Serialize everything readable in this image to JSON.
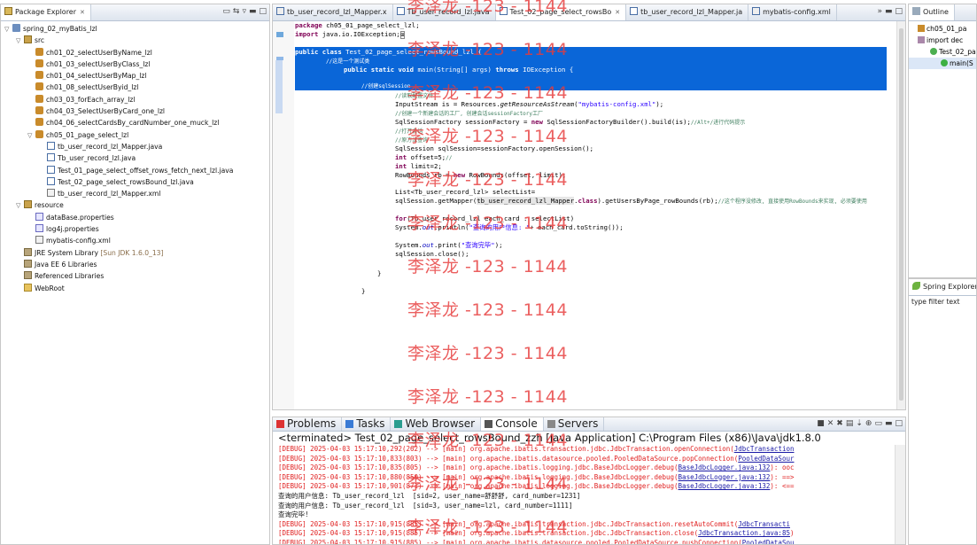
{
  "colors": {
    "selection": "#0a66d8",
    "keyword": "#7f0055",
    "comment": "#3f7f5f",
    "string": "#2a00ff",
    "error_log": "#e02020",
    "watermark": "#e63c3c"
  },
  "package_explorer": {
    "title": "Package Explorer",
    "tree": [
      {
        "label": "spring_02_myBatis_lzl",
        "icon": "project-icon",
        "indent": 0,
        "twisty": "▽"
      },
      {
        "label": "src",
        "icon": "source-folder-icon",
        "indent": 1,
        "twisty": "▽"
      },
      {
        "label": "ch01_02_selectUserByName_lzl",
        "icon": "package-icon",
        "indent": 2,
        "twisty": ""
      },
      {
        "label": "ch01_03_selectUserByClass_lzl",
        "icon": "package-icon",
        "indent": 2,
        "twisty": ""
      },
      {
        "label": "ch01_04_selectUserByMap_lzl",
        "icon": "package-icon",
        "indent": 2,
        "twisty": ""
      },
      {
        "label": "ch01_08_selectUserByid_lzl",
        "icon": "package-icon",
        "indent": 2,
        "twisty": ""
      },
      {
        "label": "ch03_03_forEach_array_lzl",
        "icon": "package-icon",
        "indent": 2,
        "twisty": ""
      },
      {
        "label": "ch04_03_SelectUserByCard_one_lzl",
        "icon": "package-icon",
        "indent": 2,
        "twisty": ""
      },
      {
        "label": "ch04_06_selectCardsBy_cardNumber_one_muck_lzl",
        "icon": "package-icon",
        "indent": 2,
        "twisty": ""
      },
      {
        "label": "ch05_01_page_select_lzl",
        "icon": "package-icon",
        "indent": 2,
        "twisty": "▽"
      },
      {
        "label": "tb_user_record_lzl_Mapper.java",
        "icon": "java-file-icon",
        "indent": 3,
        "twisty": ""
      },
      {
        "label": "Tb_user_record_lzl.java",
        "icon": "java-file-icon",
        "indent": 3,
        "twisty": ""
      },
      {
        "label": "Test_01_page_select_offset_rows_fetch_next_lzl.java",
        "icon": "java-file-icon",
        "indent": 3,
        "twisty": ""
      },
      {
        "label": "Test_02_page_select_rowsBound_lzl.java",
        "icon": "java-file-icon",
        "indent": 3,
        "twisty": ""
      },
      {
        "label": "tb_user_record_lzl_Mapper.xml",
        "icon": "xml-file-icon",
        "indent": 3,
        "twisty": ""
      },
      {
        "label": "resource",
        "icon": "source-folder-icon",
        "indent": 1,
        "twisty": "▽"
      },
      {
        "label": "dataBase.properties",
        "icon": "properties-file-icon",
        "indent": 2,
        "twisty": ""
      },
      {
        "label": "log4j.properties",
        "icon": "properties-file-icon",
        "indent": 2,
        "twisty": ""
      },
      {
        "label": "mybatis-config.xml",
        "icon": "xml-file-icon",
        "indent": 2,
        "twisty": ""
      },
      {
        "label": "JRE System Library",
        "suffix": " [Sun JDK 1.6.0_13]",
        "icon": "library-icon",
        "indent": 1,
        "twisty": ""
      },
      {
        "label": "Java EE 6 Libraries",
        "icon": "library-icon",
        "indent": 1,
        "twisty": ""
      },
      {
        "label": "Referenced Libraries",
        "icon": "library-icon",
        "indent": 1,
        "twisty": ""
      },
      {
        "label": "WebRoot",
        "icon": "folder-icon",
        "indent": 1,
        "twisty": ""
      }
    ]
  },
  "editor": {
    "tabs": [
      {
        "label": "tb_user_record_lzl_Mapper.x",
        "active": false
      },
      {
        "label": "Tb_user_record_lzl.java",
        "active": false
      },
      {
        "label": "Test_02_page_select_rowsBo",
        "active": true
      },
      {
        "label": "tb_user_record_lzl_Mapper.ja",
        "active": false
      },
      {
        "label": "mybatis-config.xml",
        "active": false
      }
    ],
    "overflow_count": "»"
  },
  "outline": {
    "title": "Outline",
    "items": [
      "ch05_01_pa",
      "import dec",
      "Test_02_pa",
      "main(S"
    ]
  },
  "spring_explorer": {
    "title": "Spring Explorer",
    "filter_placeholder": "type filter text"
  },
  "console": {
    "tabs": [
      "Problems",
      "Tasks",
      "Web Browser",
      "Console",
      "Servers"
    ],
    "header": "<terminated> Test_02_page_select_rowsBound_zzh [Java Application] C:\\Program Files (x86)\\Java\\jdk1.8.0",
    "lines": [
      {
        "kind": "err",
        "text": "[DEBUG] 2025-04-03 15:17:10,292(262) --> [main] org.apache.ibatis.transaction.jdbc.JdbcTransaction.openConnection(",
        "link": "JdbcTransaction"
      },
      {
        "kind": "err",
        "text": "[DEBUG] 2025-04-03 15:17:10,833(803) --> [main] org.apache.ibatis.datasource.pooled.PooledDataSource.popConnection(",
        "link": "PooledDataSour"
      },
      {
        "kind": "err",
        "text": "[DEBUG] 2025-04-03 15:17:10,835(805) --> [main] org.apache.ibatis.logging.jdbc.BaseJdbcLogger.debug(",
        "link": "BaseJdbcLogger.java:132",
        "tail": "): ooc"
      },
      {
        "kind": "err",
        "text": "[DEBUG] 2025-04-03 15:17:10,880(850) --> [main] org.apache.ibatis.logging.jdbc.BaseJdbcLogger.debug(",
        "link": "BaseJdbcLogger.java:132",
        "tail": "): ==>"
      },
      {
        "kind": "err",
        "text": "[DEBUG] 2025-04-03 15:17:10,901(871) --> [main] org.apache.ibatis.logging.jdbc.BaseJdbcLogger.debug(",
        "link": "BaseJdbcLogger.java:132",
        "tail": "): <=="
      },
      {
        "kind": "out",
        "text": "查询的用户信息: Tb_user_record_lzl  [sid=2, user_name=舒舒舒, card_number=1231]"
      },
      {
        "kind": "out",
        "text": "查询的用户信息: Tb_user_record_lzl  [sid=3, user_name=lzl, card_number=1111]"
      },
      {
        "kind": "out",
        "text": "查询完毕!"
      },
      {
        "kind": "err",
        "text": "[DEBUG] 2025-04-03 15:17:10,915(885) --> [main] org.apache.ibatis.transaction.jdbc.JdbcTransaction.resetAutoCommit(",
        "link": "JdbcTransacti"
      },
      {
        "kind": "err",
        "text": "[DEBUG] 2025-04-03 15:17:10,915(885) --> [main] org.apache.ibatis.transaction.jdbc.JdbcTransaction.close(",
        "link": "JdbcTransaction.java:85",
        "tail": ")"
      },
      {
        "kind": "err",
        "text": "[DEBUG] 2025-04-03 15:17:10,915(885) --> [main] org.apache.ibatis.datasource.pooled.PooledDataSource.pushConnection(",
        "link": "PooledDataSou"
      }
    ]
  },
  "watermark": "李泽龙 -123 - 1144"
}
